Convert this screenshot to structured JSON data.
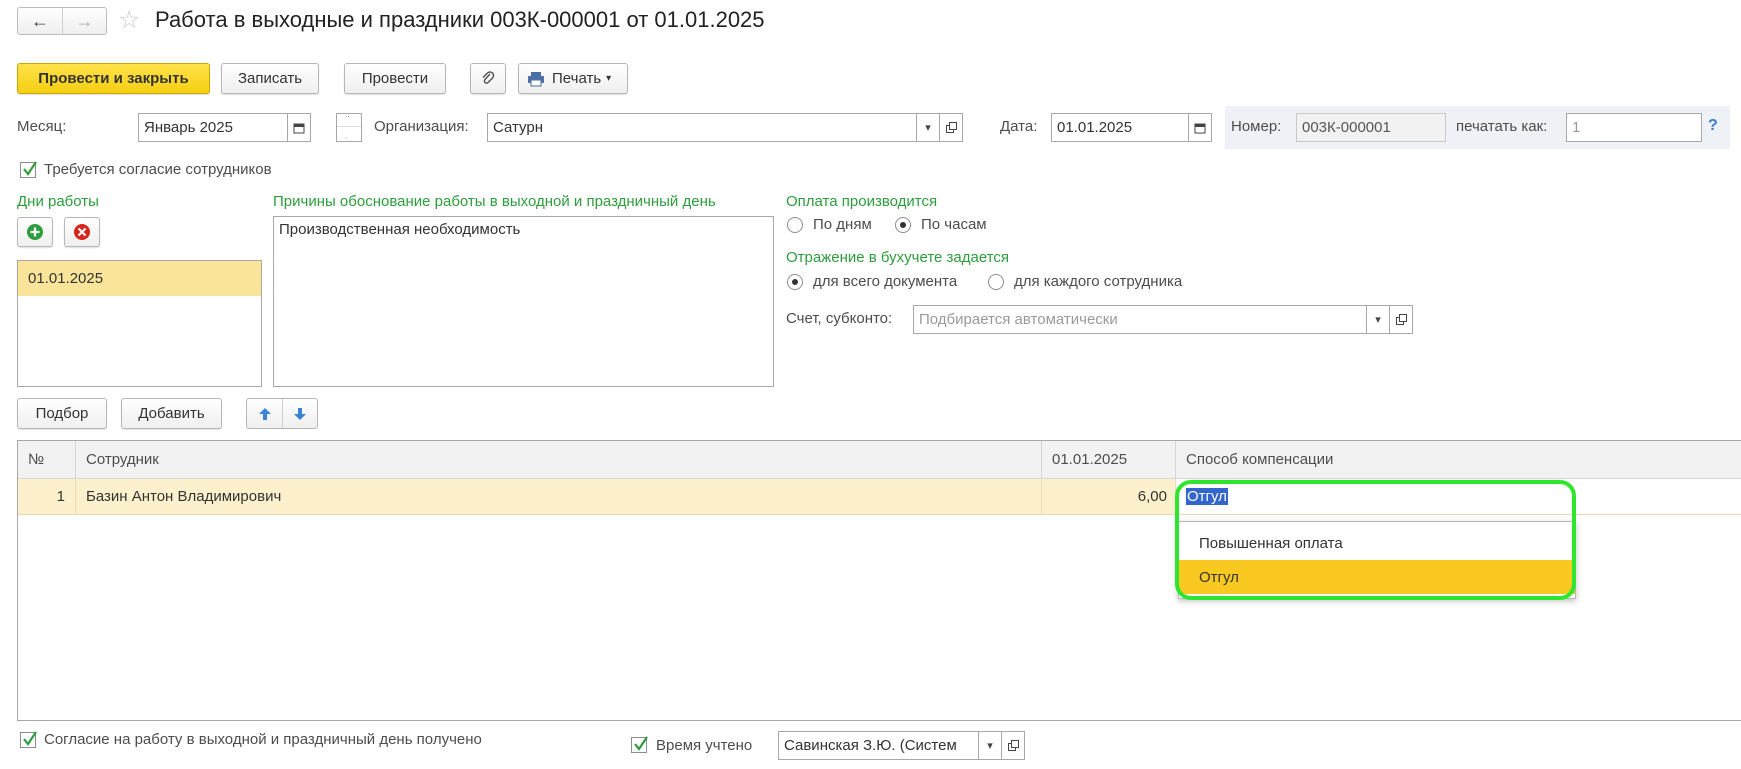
{
  "window": {
    "title": "Работа в выходные и праздники 003К-000001 от 01.01.2025"
  },
  "toolbar": {
    "post_close": "Провести и закрыть",
    "save": "Записать",
    "post": "Провести",
    "print": "Печать"
  },
  "header": {
    "month_label": "Месяц:",
    "month_value": "Январь 2025",
    "org_label": "Организация:",
    "org_value": "Сатурн",
    "date_label": "Дата:",
    "date_value": "01.01.2025",
    "number_label": "Номер:",
    "number_value": "003К-000001",
    "print_as_label": "печатать как:",
    "print_as_placeholder": "1",
    "help": "?"
  },
  "consent_required": {
    "label": "Требуется согласие сотрудников",
    "checked": true
  },
  "work_days": {
    "title": "Дни работы",
    "items": [
      "01.01.2025"
    ]
  },
  "reasons": {
    "title": "Причины обоснование работы в выходной и праздничный день",
    "text": "Производственная необходимость"
  },
  "payment": {
    "title": "Оплата производится",
    "options": [
      "По дням",
      "По часам"
    ],
    "selected": "По часам"
  },
  "accounting": {
    "title": "Отражение в бухучете задается",
    "options": [
      "для всего документа",
      "для каждого сотрудника"
    ],
    "selected": "для всего документа",
    "account_label": "Счет, субконто:",
    "account_placeholder": "Подбирается автоматически"
  },
  "table_toolbar": {
    "pick": "Подбор",
    "add": "Добавить"
  },
  "table": {
    "columns": [
      "№",
      "Сотрудник",
      "01.01.2025",
      "Способ компенсации"
    ],
    "rows": [
      {
        "num": "1",
        "employee": "Базин Антон Владимирович",
        "hours": "6,00",
        "compensation": "Отгул"
      }
    ]
  },
  "dropdown": {
    "options": [
      "Повышенная оплата",
      "Отгул"
    ],
    "selected": "Отгул"
  },
  "footer": {
    "consent_received": "Согласие на работу в выходной и праздничный день получено",
    "time_counted": "Время учтено",
    "responsible_value": "Савинская З.Ю. (Систем"
  },
  "colors": {
    "accent_yellow": "#f5cf11",
    "green_label": "#2e9d3d",
    "highlight_ring": "#2ee62e",
    "row_selected": "#fcf1cc"
  }
}
